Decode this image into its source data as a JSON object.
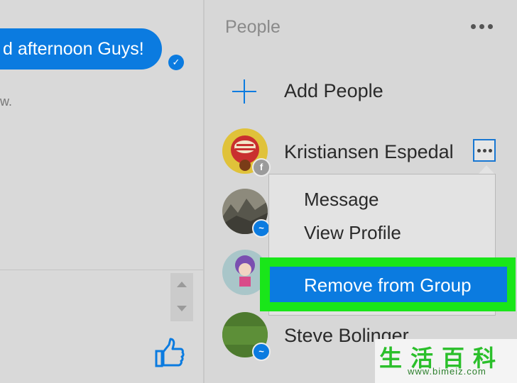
{
  "chat": {
    "bubble_text": "d afternoon Guys!",
    "fragment_text": "w."
  },
  "people_panel": {
    "title": "People",
    "add_people_label": "Add People",
    "people": [
      {
        "name": "Kristiansen Espedal",
        "badge": "facebook"
      },
      {
        "name": "",
        "badge": "messenger"
      },
      {
        "name": "",
        "badge": "messenger"
      },
      {
        "name": "Steve Bolinger",
        "badge": "messenger"
      }
    ]
  },
  "context_menu": {
    "items": [
      "Message",
      "View Profile"
    ],
    "highlighted_item": "Remove from Group"
  },
  "watermark": {
    "chars": "生活百科",
    "url": "www.bimeiz.com"
  },
  "colors": {
    "accent": "#0b7be0",
    "highlight_frame": "#19e619"
  },
  "icons": [
    "seen-check-icon",
    "like-icon",
    "more-options-icon",
    "add-icon",
    "facebook-badge-icon",
    "messenger-badge-icon",
    "scroll-up-icon",
    "scroll-down-icon"
  ]
}
